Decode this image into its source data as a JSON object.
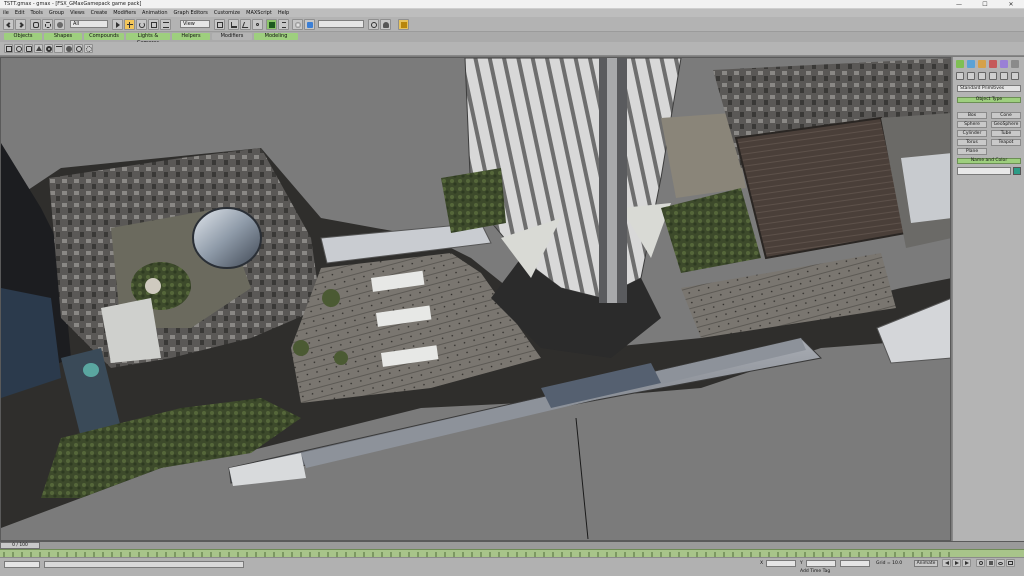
{
  "window": {
    "title": "TSTT.gmax - gmax - [FSX_GMaxGamepack game pack]",
    "minimize": "—",
    "maximize": "☐",
    "close": "✕"
  },
  "menu": [
    "ile",
    "Edit",
    "Tools",
    "Group",
    "Views",
    "Create",
    "Modifiers",
    "Animation",
    "Graph Editors",
    "Customize",
    "MAXScript",
    "Help"
  ],
  "toolbar": {
    "selection_filter": "All",
    "reference_coord": "View"
  },
  "tabs": [
    "Objects",
    "Shapes",
    "Compounds",
    "Lights & Cameras",
    "Helpers",
    "Modifiers",
    "Modeling"
  ],
  "command_panel": {
    "category_dropdown": "Standard Primitives",
    "object_type_header": "Object Type",
    "primitives": [
      "Box",
      "Cone",
      "Sphere",
      "GeoSphere",
      "Cylinder",
      "Tube",
      "Torus",
      "Teapot",
      "Plane"
    ],
    "name_color_header": "Name and Color",
    "accent_color": "#2c9c86"
  },
  "time_slider": {
    "frame_label": "0 / 100"
  },
  "status": {
    "x_label": "X",
    "y_label": "Y",
    "grid": "Grid = 10.0",
    "add_time_tag": "Add Time Tag",
    "animate": "Animate"
  },
  "icons": [
    "select-icon",
    "move-icon",
    "rotate-icon",
    "scale-icon",
    "link-icon",
    "unlink-icon",
    "undo-icon",
    "redo-icon",
    "mirror-icon",
    "align-icon",
    "snap-icon",
    "render-icon",
    "create-icon",
    "modify-icon",
    "hierarchy-icon",
    "motion-icon",
    "display-icon",
    "utilities-icon"
  ]
}
